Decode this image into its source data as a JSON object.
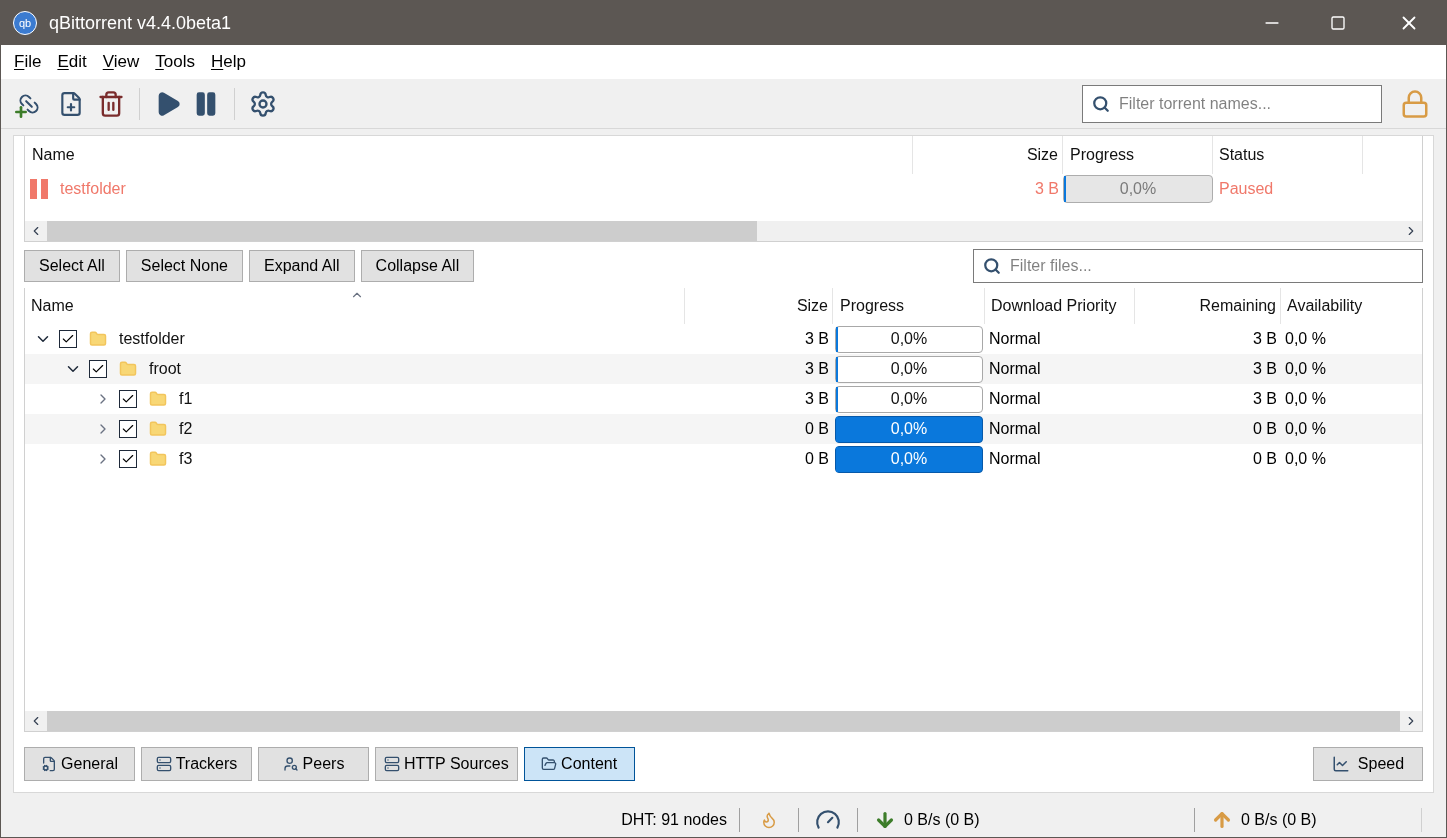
{
  "window": {
    "title": "qBittorrent v4.4.0beta1",
    "logo": "qb"
  },
  "menu": [
    {
      "label": "File"
    },
    {
      "label": "Edit"
    },
    {
      "label": "View"
    },
    {
      "label": "Tools"
    },
    {
      "label": "Help"
    }
  ],
  "toolbar": {
    "search": {
      "placeholder": "Filter torrent names..."
    }
  },
  "torrents": {
    "columns": [
      "Name",
      "Size",
      "Progress",
      "Status"
    ],
    "rows": [
      {
        "name": "testfolder",
        "size": "3 B",
        "progress": "0,0%",
        "level": 0,
        "status": "Paused",
        "paused": true
      }
    ]
  },
  "file_buttons": [
    "Select All",
    "Select None",
    "Expand All",
    "Collapse All"
  ],
  "file_filter": {
    "placeholder": "Filter files..."
  },
  "files": {
    "columns": [
      "Name",
      "Size",
      "Progress",
      "Download Priority",
      "Remaining",
      "Availability"
    ],
    "rows": [
      {
        "name": "testfolder",
        "size": "3 B",
        "progress": "0,0%",
        "level": 0,
        "highlighted": false,
        "priority": "Normal",
        "remaining": "3 B",
        "availability": "0,0 %",
        "checked": true,
        "expanded": true,
        "children": [
          {
            "name": "froot",
            "size": "3 B",
            "progress": "0,0%",
            "level": 0,
            "highlighted": false,
            "priority": "Normal",
            "remaining": "3 B",
            "availability": "0,0 %",
            "checked": true,
            "expanded": true,
            "children": [
              {
                "name": "f1",
                "size": "3 B",
                "progress": "0,0%",
                "level": 0,
                "highlighted": false,
                "priority": "Normal",
                "remaining": "3 B",
                "availability": "0,0 %",
                "checked": true,
                "expanded": false
              },
              {
                "name": "f2",
                "size": "0 B",
                "progress": "0,0%",
                "level": 0,
                "highlighted": true,
                "priority": "Normal",
                "remaining": "0 B",
                "availability": "0,0 %",
                "checked": true,
                "expanded": false
              },
              {
                "name": "f3",
                "size": "0 B",
                "progress": "0,0%",
                "level": 0,
                "highlighted": true,
                "priority": "Normal",
                "remaining": "0 B",
                "availability": "0,0 %",
                "checked": true,
                "expanded": false
              }
            ]
          }
        ]
      }
    ]
  },
  "tabs": [
    {
      "label": "General",
      "kind": "general",
      "selected": false
    },
    {
      "label": "Trackers",
      "kind": "trackers",
      "selected": false
    },
    {
      "label": "Peers",
      "kind": "peers",
      "selected": false
    },
    {
      "label": "HTTP Sources",
      "kind": "http",
      "selected": false
    },
    {
      "label": "Content",
      "kind": "content",
      "selected": true
    }
  ],
  "speed_button": "Speed",
  "status_bar": {
    "dht": "DHT: 91 nodes",
    "download": "0 B/s (0 B)",
    "upload": "0 B/s (0 B)"
  }
}
